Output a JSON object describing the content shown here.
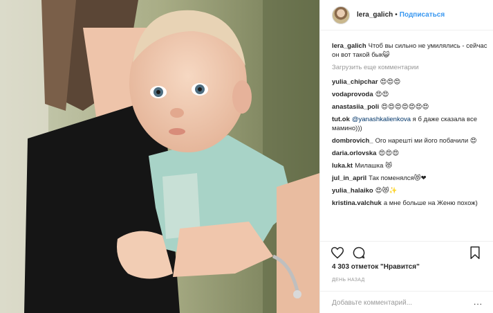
{
  "post": {
    "author": "lera_galich",
    "separator": "•",
    "follow_label": "Подписаться",
    "caption": "Чтоб вы сильно не умилялись - сейчас он вот такой бык😺",
    "load_more_label": "Загрузить еще комментарии"
  },
  "comments": [
    {
      "user": "yulia_chipchar",
      "text": "😍😍😍"
    },
    {
      "user": "vodaprovoda",
      "text": "😍😍"
    },
    {
      "user": "anastasiia_poli",
      "text": "😍😍😍😍😍😍😍"
    },
    {
      "user": "tut.ok",
      "mention": "@yanashkalienkova",
      "text": "я б даже сказала все мамино)))"
    },
    {
      "user": "dombrovich_",
      "text": "Ого нарешті ми його побачили 😍"
    },
    {
      "user": "daria.orlovska",
      "text": "😍😍😍"
    },
    {
      "user": "luka.kt",
      "text": "Милашка 😻"
    },
    {
      "user": "jul_in_april",
      "text": "Так поменялся😻❤"
    },
    {
      "user": "yulia_halaiko",
      "text": "😍😻✨"
    },
    {
      "user": "kristina.valchuk",
      "text": "а мне больше на Женю похож)"
    }
  ],
  "actions": {
    "like_icon": "heart-icon",
    "comment_icon": "comment-icon",
    "save_icon": "bookmark-icon"
  },
  "likes_label": "4 303 отметок \"Нравится\"",
  "time_label": "день назад",
  "add_comment": {
    "placeholder": "Добавьте комментарий...",
    "more_label": "..."
  },
  "colors": {
    "link": "#3897f0",
    "mention": "#003569",
    "muted": "#999999",
    "border": "#efefef"
  }
}
